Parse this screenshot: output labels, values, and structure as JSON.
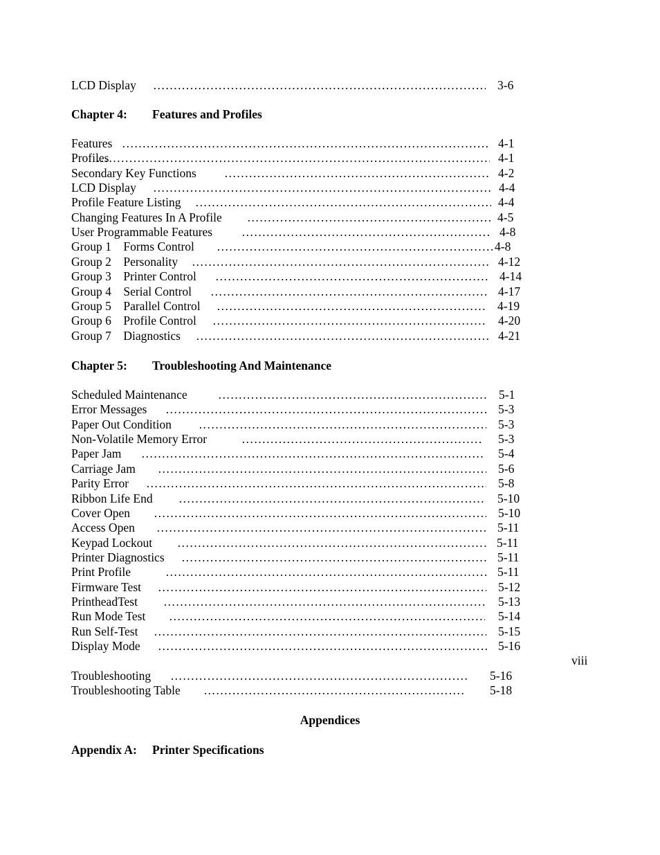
{
  "document": {
    "page_number": "viii",
    "leader": "……………………………………………………………………………………………………………………………………………",
    "top_entries": [
      {
        "title": "LCD Display",
        "page": "3-6"
      }
    ],
    "chapter4": {
      "label": "Chapter 4:",
      "title": "Features and Profiles",
      "entries": [
        {
          "title": "Features",
          "page": "4-1"
        },
        {
          "title": "Profiles",
          "page": "4-1"
        },
        {
          "title": "Secondary Key Functions",
          "page": "4-2"
        },
        {
          "title": "LCD Display",
          "page": "4-4"
        },
        {
          "title": "Profile Feature Listing",
          "page": "4-4"
        },
        {
          "title": "Changing Features In A Profile",
          "page": "4-5"
        },
        {
          "title": "User Programmable Features",
          "page": "4-8"
        },
        {
          "title": "Group 1    Forms Control",
          "page": "4-8"
        },
        {
          "title": "Group 2    Personality",
          "page": "4-12"
        },
        {
          "title": "Group 3    Printer Control",
          "page": "4-14"
        },
        {
          "title": "Group 4    Serial Control",
          "page": "4-17"
        },
        {
          "title": "Group 5    Parallel Control",
          "page": "4-19"
        },
        {
          "title": "Group 6    Profile Control",
          "page": "4-20"
        },
        {
          "title": "Group 7    Diagnostics",
          "page": "4-21"
        }
      ]
    },
    "chapter5": {
      "label": "Chapter 5:",
      "title": "Troubleshooting And Maintenance",
      "entries": [
        {
          "title": "Scheduled Maintenance",
          "page": "5-1"
        },
        {
          "title": "Error Messages",
          "page": "5-3"
        },
        {
          "title": "Paper Out Condition",
          "page": "5-3"
        },
        {
          "title": "Non-Volatile Memory Error",
          "page": "5-3"
        },
        {
          "title": "Paper Jam",
          "page": "5-4"
        },
        {
          "title": "Carriage Jam",
          "page": "5-6"
        },
        {
          "title": "Parity Error",
          "page": "5-8"
        },
        {
          "title": "Ribbon Life End",
          "page": "5-10"
        },
        {
          "title": "Cover Open",
          "page": "5-10"
        },
        {
          "title": "Access Open",
          "page": "5-11"
        },
        {
          "title": "Keypad Lockout",
          "page": "5-11"
        },
        {
          "title": "Printer Diagnostics",
          "page": "5-11"
        },
        {
          "title": "Print Profile",
          "page": "5-11"
        },
        {
          "title": "Firmware Test",
          "page": "5-12"
        },
        {
          "title": "PrintheadTest",
          "page": "5-13"
        },
        {
          "title": "Run Mode Test",
          "page": "5-14"
        },
        {
          "title": "Run Self-Test",
          "page": "5-15"
        },
        {
          "title": "Display Mode",
          "page": "5-16"
        }
      ],
      "after_break_entries": [
        {
          "title": "Troubleshooting",
          "page": "5-16"
        },
        {
          "title": "Troubleshooting Table",
          "page": "5-18"
        }
      ]
    },
    "appendices": {
      "heading": "Appendices",
      "appendix_a_label": "Appendix A:",
      "appendix_a_title": "Printer Specifications"
    }
  }
}
